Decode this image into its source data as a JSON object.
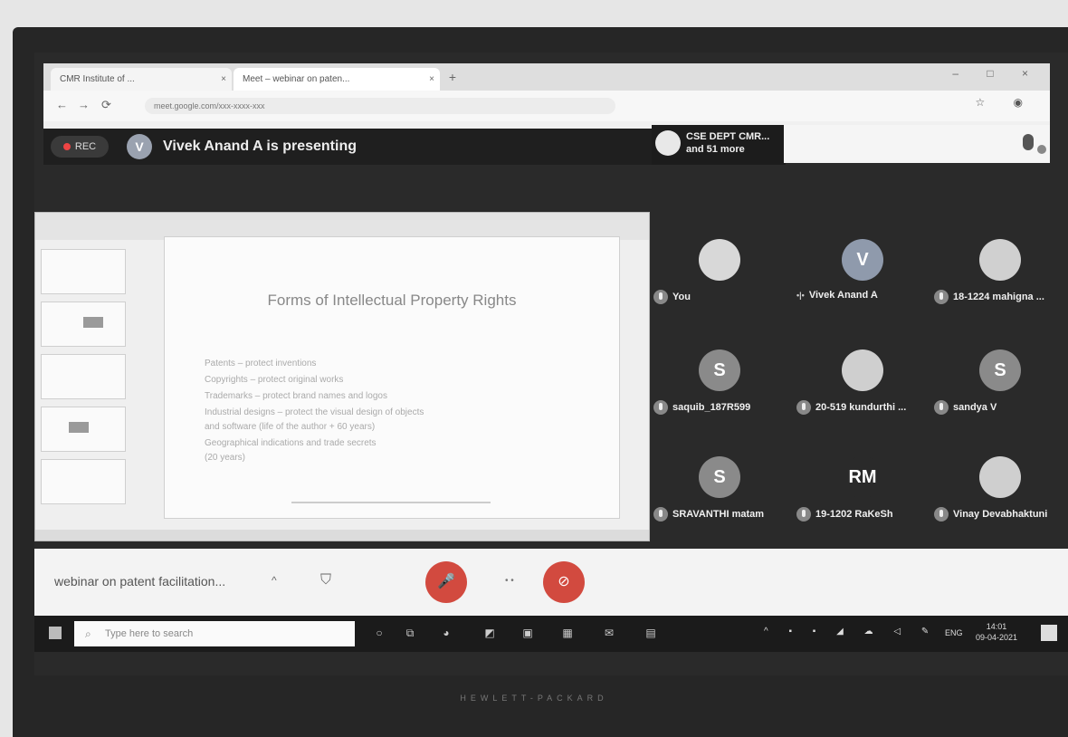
{
  "browser": {
    "tabs": [
      {
        "label": "CMR Institute of ..."
      },
      {
        "label": "Meet – webinar on paten..."
      }
    ],
    "tab_close": "×",
    "new_tab": "+",
    "window_controls": "– □ ×",
    "url": "meet.google.com/xxx-xxxx-xxx",
    "nav": {
      "back": "←",
      "forward": "→",
      "reload": "⟳"
    }
  },
  "meet_header": {
    "rec_label": "REC",
    "presenter_initial": "V",
    "presenting_text": "Vivek Anand A is presenting",
    "participants_line1": "CSE DEPT CMR...",
    "participants_line2": "and 51 more"
  },
  "presentation": {
    "slide_title": "Forms of Intellectual Property Rights",
    "bullets": [
      "Patents – protect inventions",
      "Copyrights – protect original works",
      "Trademarks – protect brand names and logos",
      "Industrial designs – protect the visual design of objects",
      "and software (life of the author + 60 years)",
      "Geographical indications and trade secrets",
      "(20 years)"
    ]
  },
  "participants": [
    {
      "name": "You",
      "initial": "",
      "color": "#d8d8d8",
      "speaking": false
    },
    {
      "name": "Vivek Anand A",
      "initial": "V",
      "color": "#8f9aac",
      "speaking": true
    },
    {
      "name": "18-1224 mahigna ...",
      "initial": "",
      "color": "#d0d0d0",
      "speaking": false
    },
    {
      "name": "saquib_187R599",
      "initial": "S",
      "color": "#8a8a8a",
      "speaking": false
    },
    {
      "name": "20-519 kundurthi ...",
      "initial": "",
      "color": "#cfcfcf",
      "speaking": false
    },
    {
      "name": "sandya V",
      "initial": "S",
      "color": "#8a8a8a",
      "speaking": false
    },
    {
      "name": "SRAVANTHI matam",
      "initial": "S",
      "color": "#8a8a8a",
      "speaking": false
    },
    {
      "name": "19-1202 RaKeSh",
      "initial": "RM",
      "color": "#2a2a2a",
      "speaking": false
    },
    {
      "name": "Vinay Devabhaktuni",
      "initial": "",
      "color": "#cfcfcf",
      "speaking": false
    }
  ],
  "controls": {
    "meeting_name": "webinar on patent facilitation...",
    "caret": "^",
    "shield": "⛉",
    "mic_off": "🎤",
    "cam_off": "⊘",
    "dots": "• •"
  },
  "taskbar": {
    "search_placeholder": "Type here to search",
    "tray": "^ ▪ ▪ ◢ ☁ ◁ ✎",
    "lang": "ENG",
    "time": "14:01",
    "date": "09-04-2021"
  },
  "brand": "HEWLETT-PACKARD"
}
